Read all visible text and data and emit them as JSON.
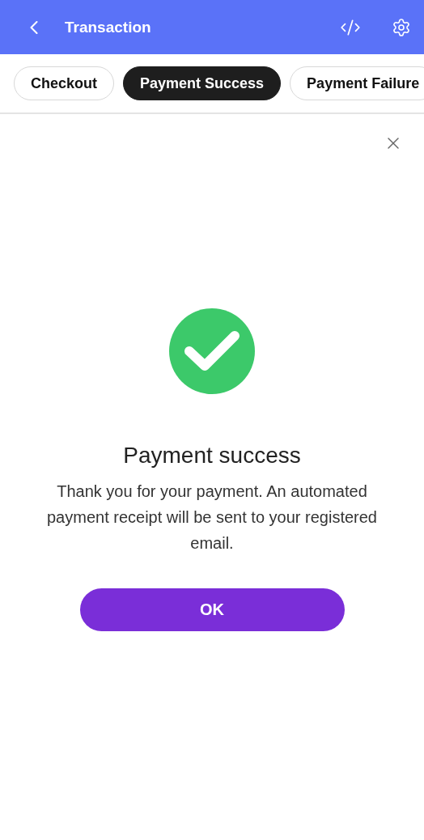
{
  "header": {
    "title": "Transaction"
  },
  "tabs": [
    {
      "label": "Checkout",
      "selected": false
    },
    {
      "label": "Payment Success",
      "selected": true
    },
    {
      "label": "Payment Failure",
      "selected": false
    }
  ],
  "dialog": {
    "success": true,
    "title": "Payment success",
    "message": "Thank you for your payment. An automated payment receipt will be sent to your registered email.",
    "button": "OK"
  }
}
